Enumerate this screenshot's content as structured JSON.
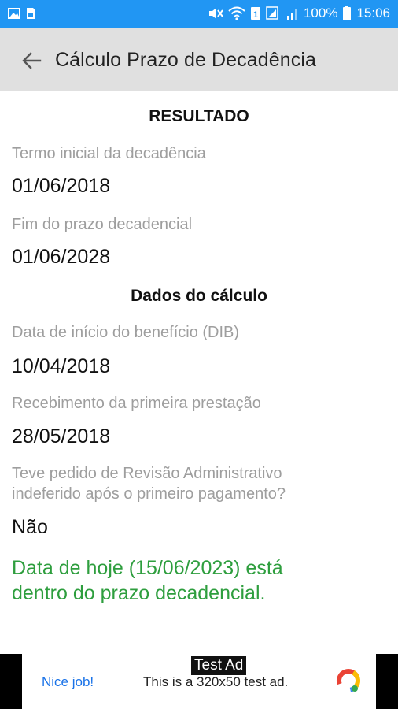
{
  "status_bar": {
    "battery": "100%",
    "time": "15:06"
  },
  "app_bar": {
    "title": "Cálculo Prazo de Decadência"
  },
  "result_section": {
    "title": "RESULTADO",
    "items": [
      {
        "label": "Termo inicial da decadência",
        "value": "01/06/2018"
      },
      {
        "label": "Fim do prazo decadencial",
        "value": "01/06/2028"
      }
    ]
  },
  "calc_section": {
    "title": "Dados do cálculo",
    "items": [
      {
        "label": "Data de início do benefício (DIB)",
        "value": "10/04/2018"
      },
      {
        "label": "Recebimento da primeira prestação",
        "value": "28/05/2018"
      },
      {
        "label_lines": [
          "Teve pedido de Revisão Administrativo",
          "indeferido após o primeiro pagamento?"
        ],
        "value": "Não"
      }
    ]
  },
  "result_message_lines": [
    "Data de hoje (15/06/2023) está",
    "dentro do prazo decadencial."
  ],
  "ad": {
    "badge": "Test Ad",
    "cta": "Nice job!",
    "text": "This is a 320x50 test ad."
  },
  "colors": {
    "status_bar": "#2196f3",
    "app_bar": "#e0e0e0",
    "success_text": "#2e9e3e",
    "label_text": "#9e9e9e"
  }
}
